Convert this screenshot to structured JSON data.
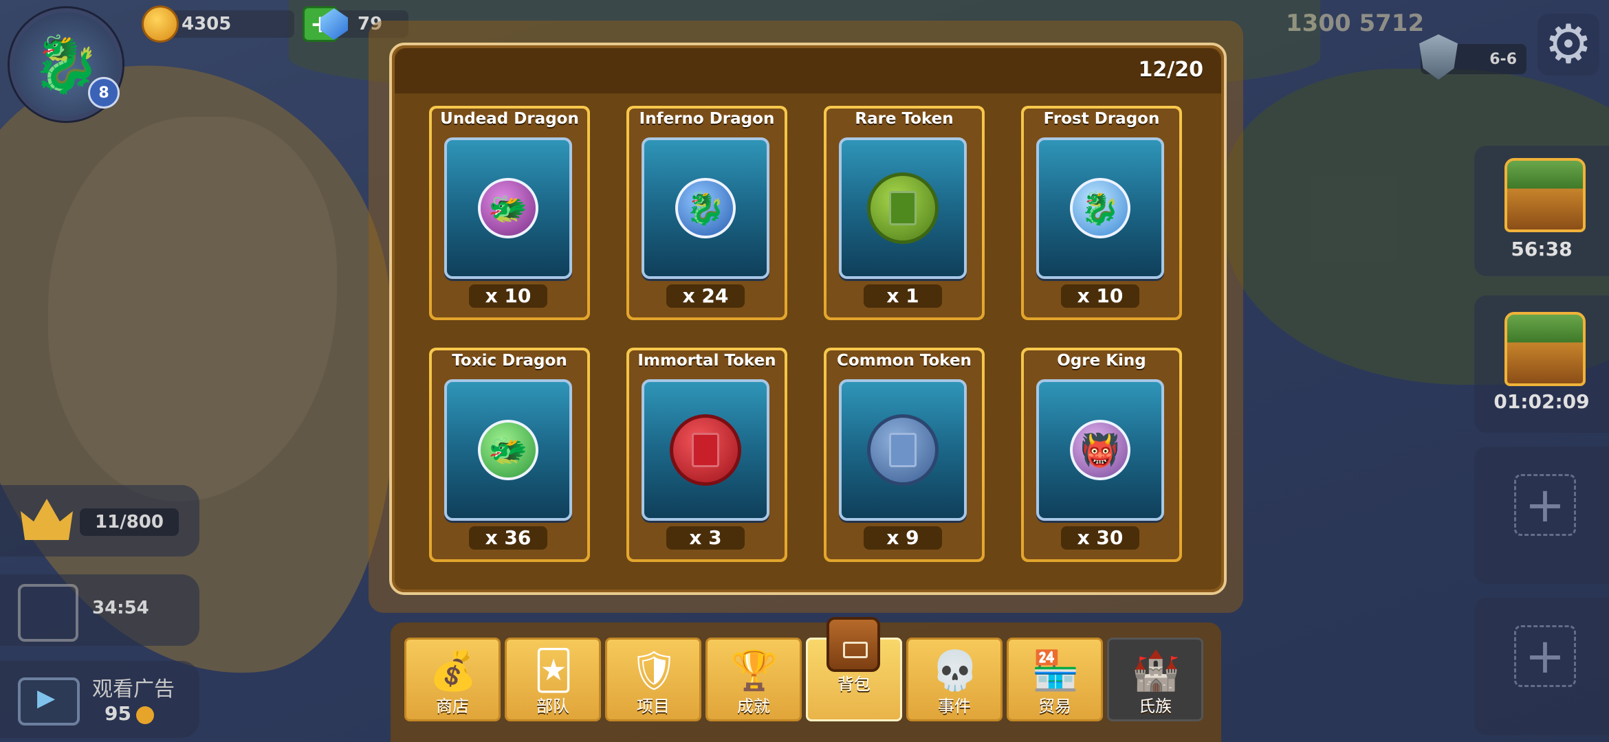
{
  "hud": {
    "coins": "4305",
    "gems": "79",
    "player_id": "1300 5712",
    "avatar_level": "8",
    "stage": "6-6"
  },
  "side_timers": [
    "56:38",
    "01:02:09"
  ],
  "left_widgets": {
    "crowns": "11/800",
    "chest_timer": "34:54",
    "ad_label": "观看广告",
    "ad_reward": "95"
  },
  "inventory": {
    "capacity": "12/20",
    "items": [
      {
        "name": "Undead Dragon",
        "qty": "x 10",
        "icon": "undead-dragon-icon"
      },
      {
        "name": "Inferno Dragon",
        "qty": "x 24",
        "icon": "inferno-dragon-icon"
      },
      {
        "name": "Rare Token",
        "qty": "x 1",
        "icon": "rare-token-icon"
      },
      {
        "name": "Frost Dragon",
        "qty": "x 10",
        "icon": "frost-dragon-icon"
      },
      {
        "name": "Toxic Dragon",
        "qty": "x 36",
        "icon": "toxic-dragon-icon"
      },
      {
        "name": "Immortal Token",
        "qty": "x 3",
        "icon": "immortal-token-icon"
      },
      {
        "name": "Common Token",
        "qty": "x 9",
        "icon": "common-token-icon"
      },
      {
        "name": "Ogre King",
        "qty": "x 30",
        "icon": "ogre-king-icon"
      }
    ]
  },
  "nav": [
    {
      "label": "商店",
      "icon": "shop-bag-icon"
    },
    {
      "label": "部队",
      "icon": "troops-card-icon"
    },
    {
      "label": "项目",
      "icon": "sword-shield-icon"
    },
    {
      "label": "成就",
      "icon": "trophy-icon"
    },
    {
      "label": "背包",
      "icon": "backpack-icon"
    },
    {
      "label": "事件",
      "icon": "skull-gate-icon"
    },
    {
      "label": "贸易",
      "icon": "market-stall-icon"
    },
    {
      "label": "氏族",
      "icon": "castle-icon"
    }
  ],
  "colors": {
    "panel": "#6b4513",
    "card_frame": "#f7c84c",
    "card_art": "#1d6a8c",
    "nav_tab": "#f6c95a"
  }
}
